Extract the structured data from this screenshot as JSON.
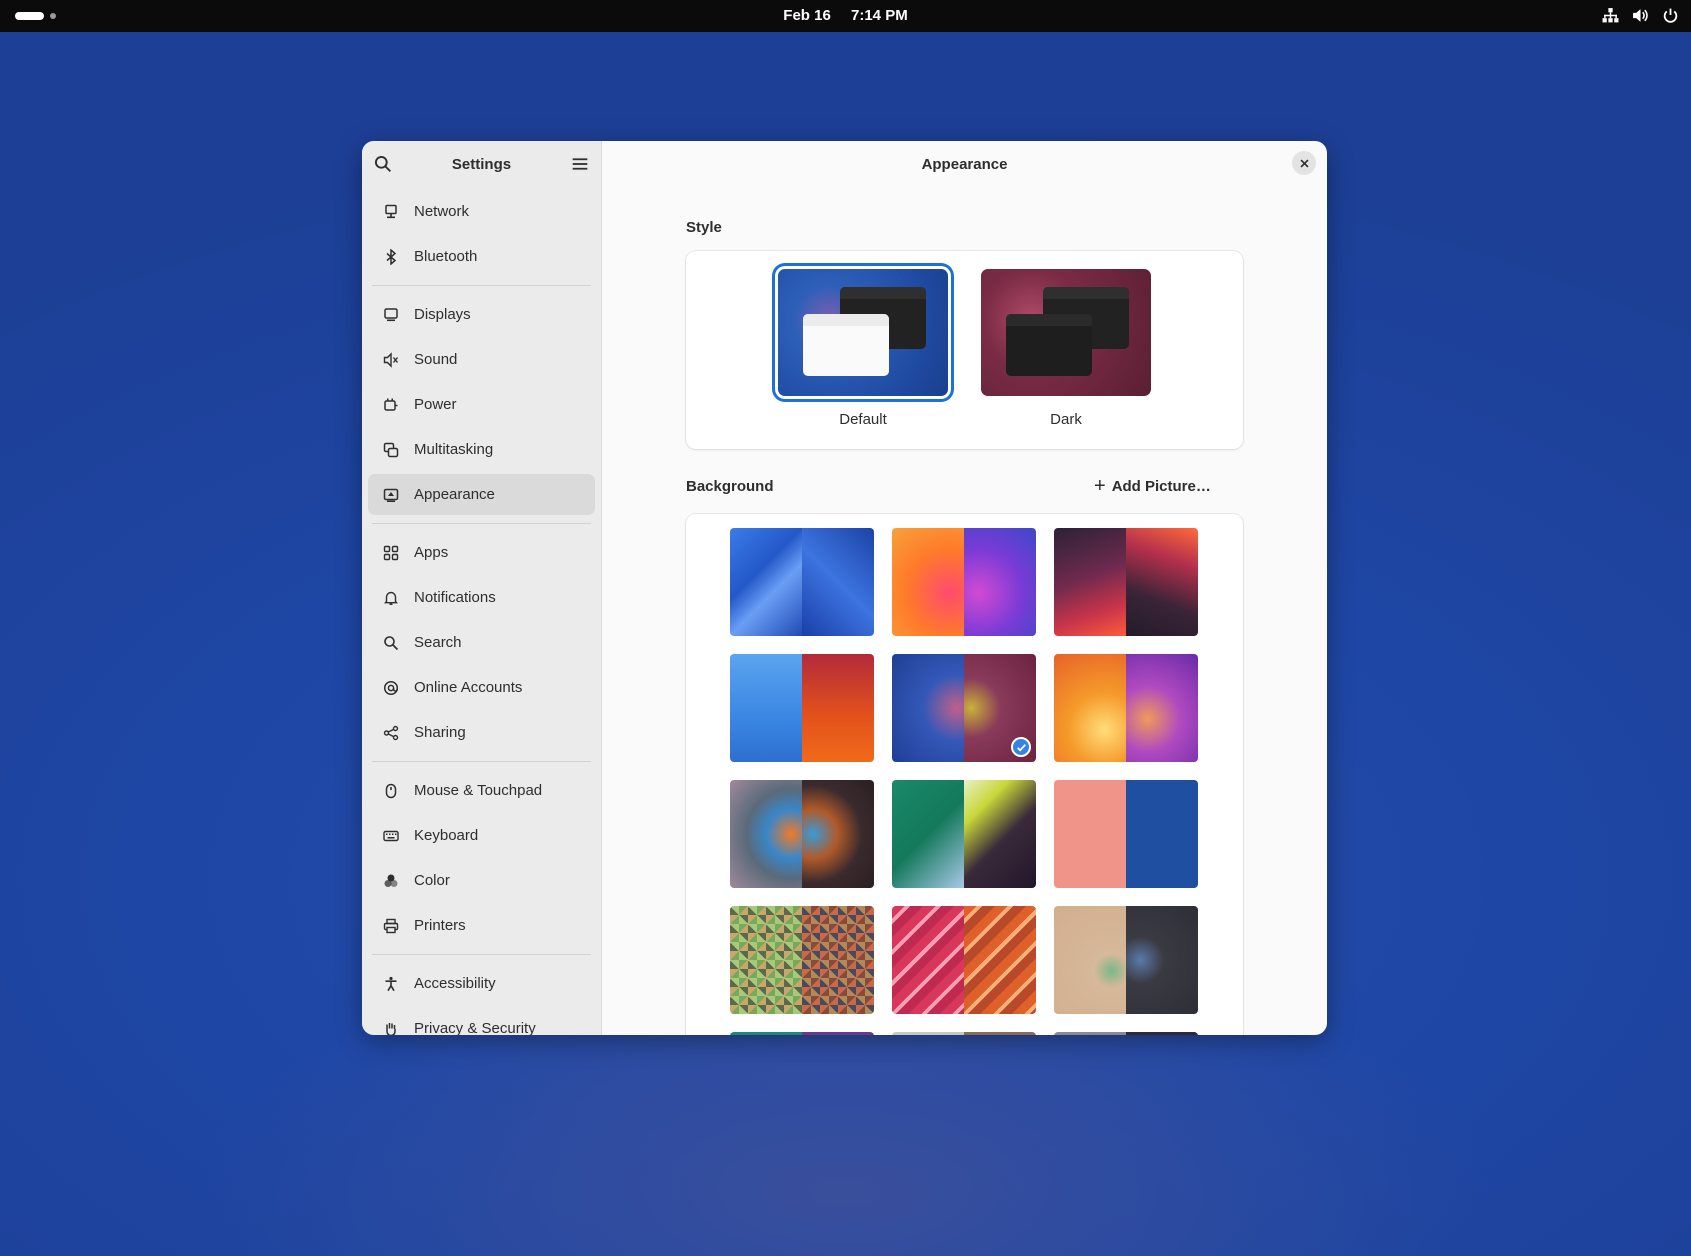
{
  "topbar": {
    "date": "Feb 16",
    "time": "7:14 PM",
    "icons": [
      "network-icon",
      "volume-icon",
      "power-icon"
    ]
  },
  "sidebar": {
    "title": "Settings",
    "groups": [
      [
        {
          "label": "Network",
          "icon": "network-icon"
        },
        {
          "label": "Bluetooth",
          "icon": "bluetooth-icon"
        }
      ],
      [
        {
          "label": "Displays",
          "icon": "display-icon"
        },
        {
          "label": "Sound",
          "icon": "sound-icon"
        },
        {
          "label": "Power",
          "icon": "power-icon"
        },
        {
          "label": "Multitasking",
          "icon": "multitasking-icon"
        },
        {
          "label": "Appearance",
          "icon": "appearance-icon",
          "active": true
        }
      ],
      [
        {
          "label": "Apps",
          "icon": "apps-icon"
        },
        {
          "label": "Notifications",
          "icon": "bell-icon"
        },
        {
          "label": "Search",
          "icon": "search-icon"
        },
        {
          "label": "Online Accounts",
          "icon": "at-icon"
        },
        {
          "label": "Sharing",
          "icon": "share-icon"
        }
      ],
      [
        {
          "label": "Mouse & Touchpad",
          "icon": "mouse-icon"
        },
        {
          "label": "Keyboard",
          "icon": "keyboard-icon"
        },
        {
          "label": "Color",
          "icon": "color-icon"
        },
        {
          "label": "Printers",
          "icon": "printer-icon"
        }
      ],
      [
        {
          "label": "Accessibility",
          "icon": "accessibility-icon"
        },
        {
          "label": "Privacy & Security",
          "icon": "hand-icon"
        }
      ]
    ]
  },
  "main": {
    "title": "Appearance",
    "style": {
      "section_title": "Style",
      "options": [
        {
          "label": "Default",
          "selected": true
        },
        {
          "label": "Dark",
          "selected": false
        }
      ]
    },
    "background": {
      "section_title": "Background",
      "add_label": "Add Picture…",
      "selected_index": 4,
      "accent": "#3584e4"
    }
  }
}
